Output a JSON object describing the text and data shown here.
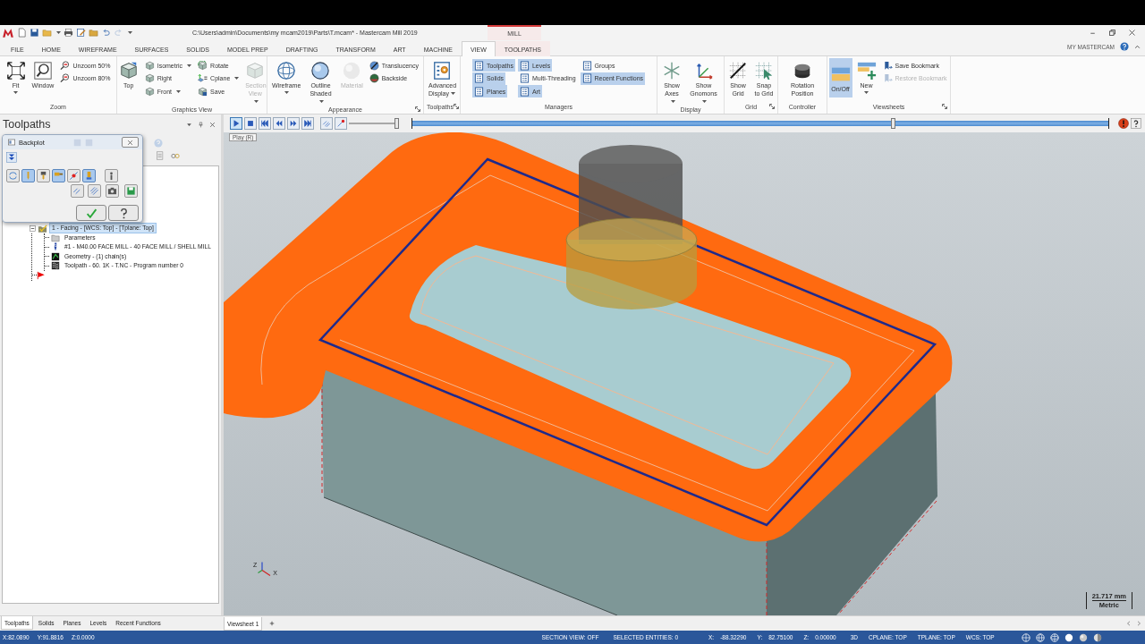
{
  "window": {
    "title": "C:\\Users\\admin\\Documents\\my mcam2019\\Parts\\T.mcam* - Mastercam Mill 2019",
    "context_label": "MILL"
  },
  "ribbon": {
    "tabs": [
      {
        "label": "FILE",
        "selected": false,
        "contextual": false
      },
      {
        "label": "HOME",
        "selected": false,
        "contextual": false
      },
      {
        "label": "WIREFRAME",
        "selected": false,
        "contextual": false
      },
      {
        "label": "SURFACES",
        "selected": false,
        "contextual": false
      },
      {
        "label": "SOLIDS",
        "selected": false,
        "contextual": false
      },
      {
        "label": "MODEL PREP",
        "selected": false,
        "contextual": false
      },
      {
        "label": "DRAFTING",
        "selected": false,
        "contextual": false
      },
      {
        "label": "TRANSFORM",
        "selected": false,
        "contextual": false
      },
      {
        "label": "ART",
        "selected": false,
        "contextual": false
      },
      {
        "label": "MACHINE",
        "selected": false,
        "contextual": false
      },
      {
        "label": "VIEW",
        "selected": true,
        "contextual": false
      },
      {
        "label": "TOOLPATHS",
        "selected": false,
        "contextual": true
      }
    ],
    "account": "MY MASTERCAM",
    "groups": [
      {
        "label": "Zoom",
        "launcher": false,
        "items": [
          {
            "kind": "large",
            "label": "Fit",
            "dropdown": true,
            "disabled": false,
            "selected": false
          },
          {
            "kind": "large",
            "label": "Window",
            "dropdown": false,
            "disabled": false,
            "selected": false
          },
          {
            "kind": "small",
            "label": "Unzoom 50%",
            "dropdown": false,
            "disabled": false,
            "selected": false
          },
          {
            "kind": "small",
            "label": "Unzoom 80%",
            "dropdown": false,
            "disabled": false,
            "selected": false
          }
        ]
      },
      {
        "label": "Graphics View",
        "launcher": false,
        "items": [
          {
            "kind": "large",
            "label": "Top",
            "dropdown": false,
            "disabled": false,
            "selected": false
          },
          {
            "kind": "small",
            "label": "Isometric",
            "dropdown": true,
            "disabled": false,
            "selected": false
          },
          {
            "kind": "small",
            "label": "Right",
            "dropdown": false,
            "disabled": false,
            "selected": false
          },
          {
            "kind": "small",
            "label": "Front",
            "dropdown": true,
            "disabled": false,
            "selected": false
          },
          {
            "kind": "small",
            "label": "Rotate",
            "dropdown": false,
            "disabled": false,
            "selected": false
          },
          {
            "kind": "small",
            "label": "Cplane",
            "dropdown": true,
            "disabled": false,
            "selected": false
          },
          {
            "kind": "small",
            "label": "Save",
            "dropdown": false,
            "disabled": false,
            "selected": false
          },
          {
            "kind": "large",
            "label": "Section\nView",
            "dropdown": true,
            "disabled": true,
            "selected": false
          }
        ]
      },
      {
        "label": "Appearance",
        "launcher": true,
        "items": [
          {
            "kind": "large",
            "label": "Wireframe",
            "dropdown": true,
            "disabled": false,
            "selected": false
          },
          {
            "kind": "large",
            "label": "Outline\nShaded",
            "dropdown": true,
            "disabled": false,
            "selected": false
          },
          {
            "kind": "large",
            "label": "Material",
            "dropdown": false,
            "disabled": true,
            "selected": false
          },
          {
            "kind": "small",
            "label": "Translucency",
            "dropdown": false,
            "disabled": false,
            "selected": false
          },
          {
            "kind": "small",
            "label": "Backside",
            "dropdown": false,
            "disabled": false,
            "selected": false
          }
        ]
      },
      {
        "label": "Toolpaths",
        "launcher": true,
        "items": [
          {
            "kind": "large",
            "label": "Advanced\nDisplay",
            "dropdown": true,
            "disabled": false,
            "selected": false
          }
        ]
      },
      {
        "label": "Managers",
        "launcher": false,
        "items": [
          {
            "kind": "small",
            "label": "Toolpaths",
            "dropdown": false,
            "disabled": false,
            "selected": true
          },
          {
            "kind": "small",
            "label": "Solids",
            "dropdown": false,
            "disabled": false,
            "selected": true
          },
          {
            "kind": "small",
            "label": "Planes",
            "dropdown": false,
            "disabled": false,
            "selected": true
          },
          {
            "kind": "small",
            "label": "Levels",
            "dropdown": false,
            "disabled": false,
            "selected": true
          },
          {
            "kind": "small",
            "label": "Multi-Threading",
            "dropdown": false,
            "disabled": false,
            "selected": false
          },
          {
            "kind": "small",
            "label": "Art",
            "dropdown": false,
            "disabled": false,
            "selected": true
          },
          {
            "kind": "small",
            "label": "Groups",
            "dropdown": false,
            "disabled": false,
            "selected": false
          },
          {
            "kind": "small",
            "label": "Recent Functions",
            "dropdown": false,
            "disabled": false,
            "selected": true
          }
        ]
      },
      {
        "label": "Display",
        "launcher": false,
        "items": [
          {
            "kind": "large",
            "label": "Show\nAxes",
            "dropdown": true,
            "disabled": false,
            "selected": false
          },
          {
            "kind": "large",
            "label": "Show\nGnomons",
            "dropdown": true,
            "disabled": false,
            "selected": false
          }
        ]
      },
      {
        "label": "Grid",
        "launcher": true,
        "items": [
          {
            "kind": "large",
            "label": "Show\nGrid",
            "dropdown": false,
            "disabled": false,
            "selected": false
          },
          {
            "kind": "large",
            "label": "Snap\nto Grid",
            "dropdown": false,
            "disabled": false,
            "selected": false
          }
        ]
      },
      {
        "label": "Controller",
        "launcher": false,
        "items": [
          {
            "kind": "large",
            "label": "Rotation\nPosition",
            "dropdown": false,
            "disabled": false,
            "selected": false
          }
        ]
      },
      {
        "label": "Viewsheets",
        "launcher": true,
        "items": [
          {
            "kind": "large",
            "label": "On/Off",
            "dropdown": false,
            "disabled": false,
            "selected": true
          },
          {
            "kind": "large",
            "label": "New",
            "dropdown": true,
            "disabled": false,
            "selected": false
          },
          {
            "kind": "small",
            "label": "Save Bookmark",
            "dropdown": false,
            "disabled": false,
            "selected": false
          },
          {
            "kind": "small",
            "label": "Restore Bookmark",
            "dropdown": false,
            "disabled": true,
            "selected": false
          }
        ]
      }
    ]
  },
  "toolpaths_panel": {
    "title": "Toolpaths",
    "tree": [
      {
        "kind": "operation",
        "label": "1 - Facing - [WCS: Top] - [Tplane: Top]",
        "selected": true,
        "children": [
          {
            "kind": "parameters",
            "label": "Parameters",
            "selected": false
          },
          {
            "kind": "tool",
            "label": "#1 - M40.00 FACE MILL - 40 FACE MILL / SHELL MILL",
            "selected": false
          },
          {
            "kind": "geometry",
            "label": "Geometry - (1) chain(s)",
            "selected": false
          },
          {
            "kind": "toolpath",
            "label": "Toolpath - 60. 1K - T.NC - Program number 0",
            "selected": false
          }
        ]
      }
    ]
  },
  "backplot_dialog": {
    "title": "Backplot",
    "toggles": [
      {
        "pressed": false
      },
      {
        "pressed": true
      },
      {
        "pressed": false
      },
      {
        "pressed": true
      },
      {
        "pressed": false
      },
      {
        "pressed": true
      },
      {
        "pressed": false
      }
    ]
  },
  "playback": {
    "controls": [
      {
        "selected": true
      },
      {
        "selected": false
      },
      {
        "selected": false
      },
      {
        "selected": false
      },
      {
        "selected": false
      },
      {
        "selected": false
      },
      {
        "selected": false
      },
      {
        "selected": false
      }
    ],
    "tooltip": "Play (R)",
    "speed": {
      "level": 0.95
    },
    "position": {
      "level": 0.69
    }
  },
  "viewport": {
    "gnomon_labels": [
      "Z",
      "X"
    ],
    "scale": {
      "length": "21.717 mm",
      "units": "Metric"
    }
  },
  "panel_tabs": [
    {
      "label": "Toolpaths",
      "selected": true
    },
    {
      "label": "Solids",
      "selected": false
    },
    {
      "label": "Planes",
      "selected": false
    },
    {
      "label": "Levels",
      "selected": false
    },
    {
      "label": "Recent Functions",
      "selected": false
    }
  ],
  "viewsheet_tabs": [
    {
      "label": "Viewsheet 1",
      "selected": true
    }
  ],
  "status_bar": {
    "cursor": [
      "X:82.0890",
      "Y:91.8816",
      "Z:0.0000"
    ],
    "fields": [
      "SECTION VIEW: OFF",
      "SELECTED ENTITIES: 0"
    ],
    "coords": [
      {
        "label": "X:",
        "value": "-88.32290"
      },
      {
        "label": "Y:",
        "value": "82.75100"
      },
      {
        "label": "Z:",
        "value": "0.00000"
      }
    ],
    "planes": [
      "3D",
      "CPLANE: TOP",
      "TPLANE: TOP",
      "WCS: TOP"
    ]
  }
}
